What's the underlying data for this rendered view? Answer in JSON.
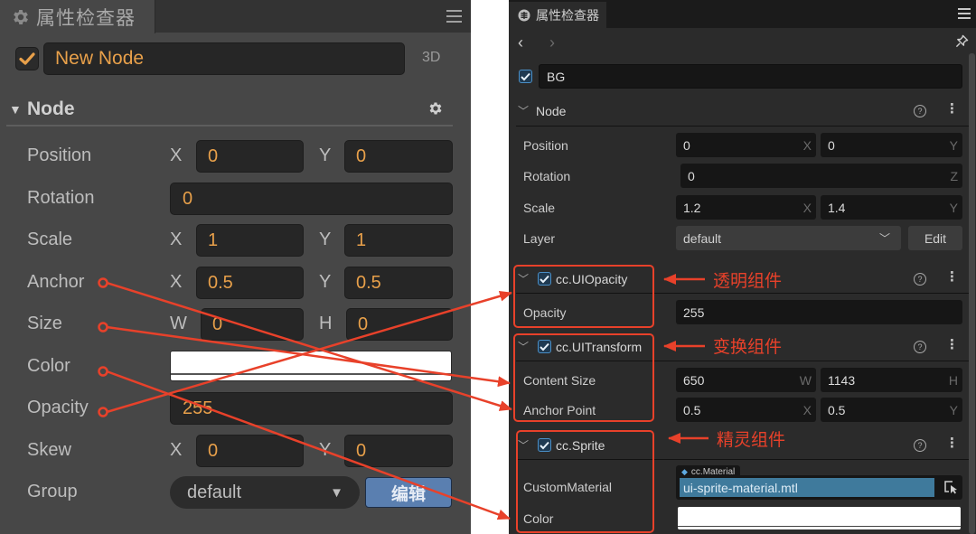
{
  "left_panel": {
    "tab_title": "属性检查器",
    "node_name": "New Node",
    "mode_label": "3D",
    "section_title": "Node",
    "properties": [
      {
        "label": "Position",
        "axis1": "X",
        "value1": "0",
        "axis2": "Y",
        "value2": "0"
      },
      {
        "label": "Rotation",
        "value": "0"
      },
      {
        "label": "Scale",
        "axis1": "X",
        "value1": "1",
        "axis2": "Y",
        "value2": "1"
      },
      {
        "label": "Anchor",
        "axis1": "X",
        "value1": "0.5",
        "axis2": "Y",
        "value2": "0.5"
      },
      {
        "label": "Size",
        "axis1": "W",
        "value1": "0",
        "axis2": "H",
        "value2": "0"
      },
      {
        "label": "Color",
        "color": "#ffffff"
      },
      {
        "label": "Opacity",
        "value": "255"
      },
      {
        "label": "Skew",
        "axis1": "X",
        "value1": "0",
        "axis2": "Y",
        "value2": "0"
      },
      {
        "label": "Group",
        "select_value": "default",
        "button_label": "编辑"
      }
    ]
  },
  "right_panel": {
    "tab_title": "属性检查器",
    "node_name": "BG",
    "node_section": {
      "title": "Node",
      "position": {
        "label": "Position",
        "x": "0",
        "y": "0",
        "x_axis": "X",
        "y_axis": "Y"
      },
      "rotation": {
        "label": "Rotation",
        "z": "0",
        "z_axis": "Z"
      },
      "scale": {
        "label": "Scale",
        "x": "1.2",
        "y": "1.4",
        "x_axis": "X",
        "y_axis": "Y"
      },
      "layer": {
        "label": "Layer",
        "value": "default",
        "button_label": "Edit"
      }
    },
    "ui_opacity": {
      "title": "cc.UIOpacity",
      "opacity": {
        "label": "Opacity",
        "value": "255"
      }
    },
    "ui_transform": {
      "title": "cc.UITransform",
      "content_size": {
        "label": "Content Size",
        "w": "650",
        "h": "1143",
        "w_axis": "W",
        "h_axis": "H"
      },
      "anchor_point": {
        "label": "Anchor Point",
        "x": "0.5",
        "y": "0.5",
        "x_axis": "X",
        "y_axis": "Y"
      }
    },
    "sprite": {
      "title": "cc.Sprite",
      "custom_material": {
        "label": "CustomMaterial",
        "type_tag": "cc.Material",
        "value": "ui-sprite-material.mtl"
      },
      "color": {
        "label": "Color",
        "value": "#ffffff"
      }
    },
    "help_glyph": "?"
  },
  "annotations": {
    "opacity_component": "透明组件",
    "transform_component": "变换组件",
    "sprite_component": "精灵组件",
    "accent_color": "#e8412a"
  },
  "colors": {
    "left_value_text": "#e8a04a",
    "left_button": "#5a7fb0",
    "right_checkbox": "#4a8fc7",
    "right_material_field": "#3f7a9c"
  }
}
